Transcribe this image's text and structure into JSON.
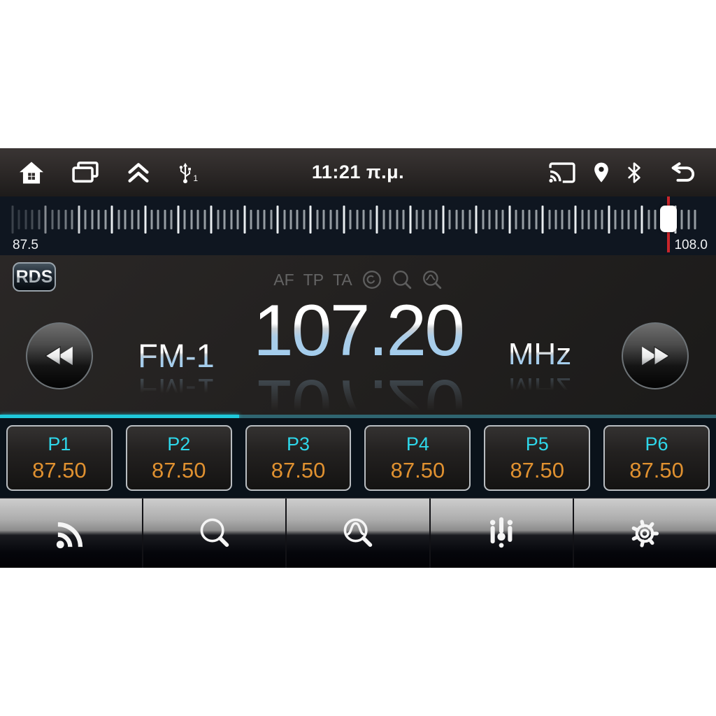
{
  "status_bar": {
    "time": "11:21 π.μ.",
    "usb_badge": "1"
  },
  "tuner": {
    "rds_label": "RDS",
    "indicators": {
      "af": "AF",
      "tp": "TP",
      "ta": "TA"
    },
    "band_label": "FM-1",
    "frequency_display": "107.20",
    "frequency_value": 107.2,
    "unit": "MHz",
    "band_min": 87.5,
    "band_max": 108.0,
    "band_min_label": "87.5",
    "band_max_label": "108.0"
  },
  "tuning_progress": {
    "bright_fraction": 0.334
  },
  "presets": [
    {
      "label": "P1",
      "frequency": "87.50"
    },
    {
      "label": "P2",
      "frequency": "87.50"
    },
    {
      "label": "P3",
      "frequency": "87.50"
    },
    {
      "label": "P4",
      "frequency": "87.50"
    },
    {
      "label": "P5",
      "frequency": "87.50"
    },
    {
      "label": "P6",
      "frequency": "87.50"
    }
  ],
  "colors": {
    "accent_cyan": "#1fc9db",
    "dim_teal": "#2f6570",
    "preset_label": "#2ed7ea",
    "preset_value": "#e09130",
    "indicator_red": "#c9252b"
  }
}
